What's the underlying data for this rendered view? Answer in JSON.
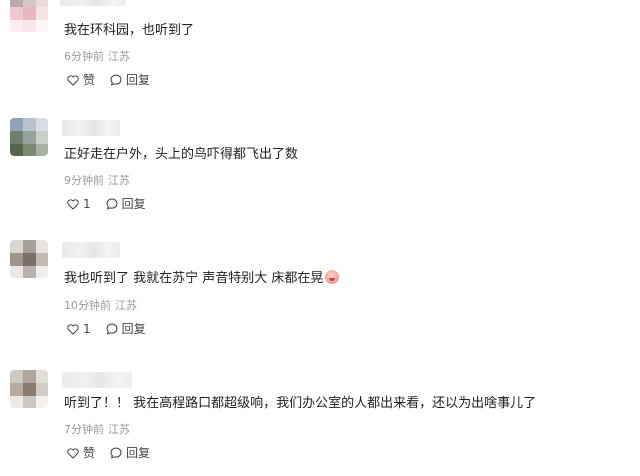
{
  "comments": [
    {
      "text": "我在环科园，也听到了",
      "time": "6分钟前",
      "location": "江苏",
      "like_label": "赞",
      "reply_label": "回复"
    },
    {
      "text": "正好走在户外，头上的鸟吓得都飞出了数",
      "time": "9分钟前",
      "location": "江苏",
      "like_label": "1",
      "reply_label": "回复"
    },
    {
      "text": "我也听到了 我就在苏宁 声音特别大 床都在晃",
      "time": "10分钟前",
      "location": "江苏",
      "like_label": "1",
      "reply_label": "回复"
    },
    {
      "text": "听到了！！ 我在高程路口都超级响，我们办公室的人都出来看，还以为出啥事儿了",
      "time": "7分钟前",
      "location": "江苏",
      "like_label": "赞",
      "reply_label": "回复"
    }
  ],
  "icons": {
    "like": "heart-outline-icon",
    "reply": "chat-bubble-icon",
    "emoji": "crying-face-emoji-icon"
  }
}
